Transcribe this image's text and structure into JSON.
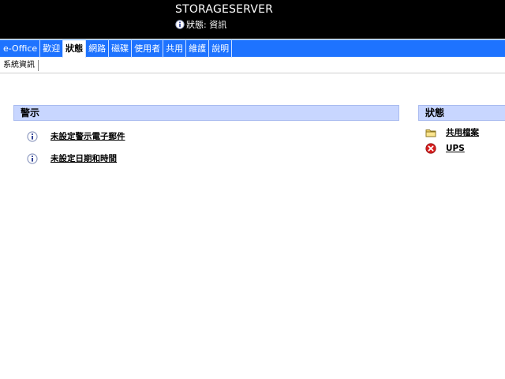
{
  "header": {
    "server_name": "STORAGESERVER",
    "status_text": "狀態: 資訊"
  },
  "nav": {
    "items": [
      {
        "label": "e-Office"
      },
      {
        "label": "歡迎"
      },
      {
        "label": "狀態"
      },
      {
        "label": "網路"
      },
      {
        "label": "磁碟"
      },
      {
        "label": "使用者"
      },
      {
        "label": "共用"
      },
      {
        "label": "維護"
      },
      {
        "label": "說明"
      }
    ],
    "active": "狀態"
  },
  "subnav": {
    "items": [
      {
        "label": "系統資訊"
      }
    ]
  },
  "alerts": {
    "title": "警示",
    "items": [
      {
        "label": "未設定警示電子郵件",
        "icon": "info-icon"
      },
      {
        "label": "未設定日期和時間",
        "icon": "info-icon"
      }
    ]
  },
  "status": {
    "title": "狀態",
    "items": [
      {
        "label": "共用檔案",
        "icon": "folder-icon"
      },
      {
        "label": "UPS",
        "icon": "error-icon"
      }
    ]
  },
  "colors": {
    "header_bg": "#000000",
    "nav_bg": "#1e73ff",
    "panel_header_bg": "#c8d6ff",
    "error_red": "#d81e1e"
  }
}
